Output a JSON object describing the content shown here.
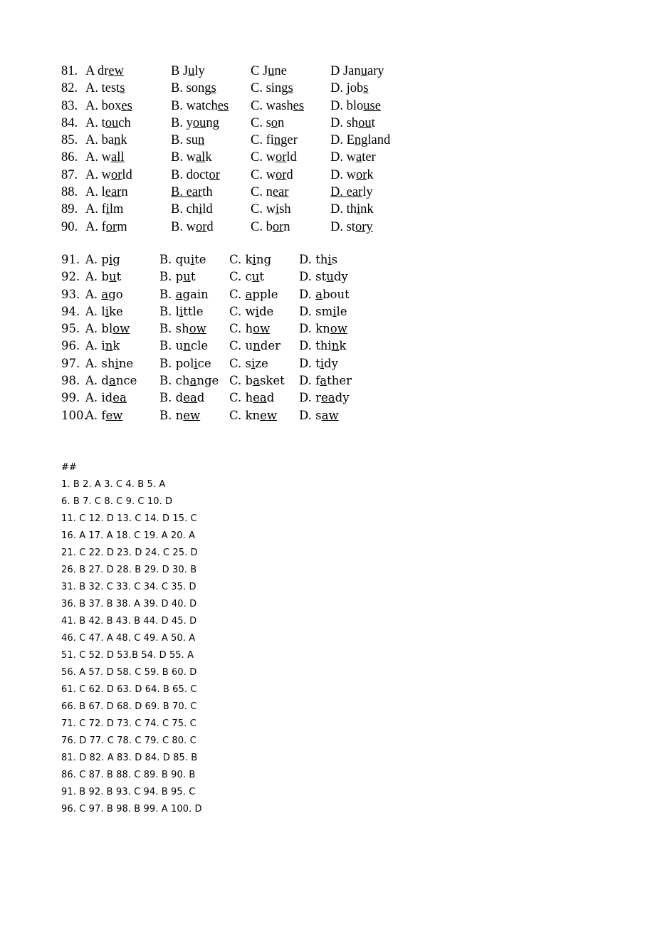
{
  "document": {
    "page_background": "#ffffff",
    "text_color": "#000000"
  },
  "question_blocks": [
    {
      "id": "block-81",
      "rows": [
        {
          "number": "81.",
          "options": [
            {
              "label": "A",
              "pre": "A dr",
              "underlined": "ew",
              "post": "",
              "text": "A drew"
            },
            {
              "label": "B",
              "pre": "B J",
              "underlined": "u",
              "post": "ly",
              "text": "B July"
            },
            {
              "label": "C",
              "pre": "C J",
              "underlined": "u",
              "post": "ne",
              "text": "C June"
            },
            {
              "label": "D",
              "pre": "D Jan",
              "underlined": "u",
              "post": "ary",
              "text": "D January"
            }
          ]
        },
        {
          "number": "82.",
          "options": [
            {
              "label": "A",
              "pre": "A. test",
              "underlined": "s",
              "post": "",
              "text": "A. tests"
            },
            {
              "label": "B",
              "pre": "B. song",
              "underlined": "s",
              "post": "",
              "text": "B. songs"
            },
            {
              "label": "C",
              "pre": "C. sing",
              "underlined": "s",
              "post": "",
              "text": "C. sings"
            },
            {
              "label": "D",
              "pre": "D. job",
              "underlined": "s",
              "post": "",
              "text": "D. jobs"
            }
          ]
        },
        {
          "number": "83.",
          "options": [
            {
              "label": "A",
              "pre": "A. box",
              "underlined": "es",
              "post": "",
              "text": "A. boxes"
            },
            {
              "label": "B",
              "pre": "B. watch",
              "underlined": "es",
              "post": "",
              "text": "B. watches"
            },
            {
              "label": "C",
              "pre": "C. wash",
              "underlined": "es",
              "post": "",
              "text": "C. washes"
            },
            {
              "label": "D",
              "pre": "D. blo",
              "underlined": "use",
              "post": "",
              "text": "D. blouse"
            }
          ]
        },
        {
          "number": "84.",
          "options": [
            {
              "label": "A",
              "pre": "A. t",
              "underlined": "ou",
              "post": "ch",
              "text": "A. touch"
            },
            {
              "label": "B",
              "pre": "B. y",
              "underlined": "ou",
              "post": "ng",
              "text": "B. young"
            },
            {
              "label": "C",
              "pre": "C. s",
              "underlined": "o",
              "post": "n",
              "text": "C. son"
            },
            {
              "label": "D",
              "pre": "D. sh",
              "underlined": "ou",
              "post": "t",
              "text": "D. shout"
            }
          ]
        },
        {
          "number": "85.",
          "options": [
            {
              "label": "A",
              "pre": "A. ba",
              "underlined": "n",
              "post": "k",
              "text": "A. bank"
            },
            {
              "label": "B",
              "pre": "B. su",
              "underlined": "n",
              "post": "",
              "text": "B. sun"
            },
            {
              "label": "C",
              "pre": "C. fi",
              "underlined": "n",
              "post": "ger",
              "text": "C. finger"
            },
            {
              "label": "D",
              "pre": "D. E",
              "underlined": "ng",
              "post": "land",
              "text": "D. England"
            }
          ]
        },
        {
          "number": "86.",
          "options": [
            {
              "label": "A",
              "pre": "A. w",
              "underlined": "all",
              "post": "",
              "text": "A. wall"
            },
            {
              "label": "B",
              "pre": "B. w",
              "underlined": "al",
              "post": "k",
              "text": "B. walk"
            },
            {
              "label": "C",
              "pre": "C. w",
              "underlined": "or",
              "post": "ld",
              "text": "C. world"
            },
            {
              "label": "D",
              "pre": "D. w",
              "underlined": "a",
              "post": "ter",
              "text": "D. water"
            }
          ]
        },
        {
          "number": "87.",
          "options": [
            {
              "label": "A",
              "pre": "A. w",
              "underlined": "or",
              "post": "ld",
              "text": "A. world"
            },
            {
              "label": "B",
              "pre": "B. doct",
              "underlined": "or",
              "post": "",
              "text": "B. doctor"
            },
            {
              "label": "C",
              "pre": "C. w",
              "underlined": "or",
              "post": "d",
              "text": "C. word"
            },
            {
              "label": "D",
              "pre": "D. w",
              "underlined": "or",
              "post": "k",
              "text": "D. work"
            }
          ]
        },
        {
          "number": "88.",
          "options": [
            {
              "label": "A",
              "pre": "A. l",
              "underlined": "ear",
              "post": "n",
              "text": "A. learn"
            },
            {
              "label": "B",
              "pre": "",
              "underlined": "B. ear",
              "post": "th",
              "text": "B. earth"
            },
            {
              "label": "C",
              "pre": "C. n",
              "underlined": "ear",
              "post": "",
              "text": "C. near"
            },
            {
              "label": "D",
              "pre": "",
              "underlined": "D. ear",
              "post": "ly",
              "text": "D. early"
            }
          ]
        },
        {
          "number": "89.",
          "options": [
            {
              "label": "A",
              "pre": "A. f",
              "underlined": "i",
              "post": "lm",
              "text": "A. film"
            },
            {
              "label": "B",
              "pre": "B. ch",
              "underlined": "i",
              "post": "ld",
              "text": "B. child"
            },
            {
              "label": "C",
              "pre": "C. w",
              "underlined": "i",
              "post": "sh",
              "text": "C. wish"
            },
            {
              "label": "D",
              "pre": "D. th",
              "underlined": "i",
              "post": "nk",
              "text": "D. think"
            }
          ]
        },
        {
          "number": "90.",
          "options": [
            {
              "label": "A",
              "pre": "A. f",
              "underlined": "or",
              "post": "m",
              "text": "A. form"
            },
            {
              "label": "B",
              "pre": "B. w",
              "underlined": "or",
              "post": "d",
              "text": "B. word"
            },
            {
              "label": "C",
              "pre": "C. b",
              "underlined": "or",
              "post": "n",
              "text": "C. born"
            },
            {
              "label": "D",
              "pre": "D. st",
              "underlined": "ory",
              "post": "",
              "text": "D. story"
            }
          ]
        }
      ]
    },
    {
      "id": "block-91",
      "rows": [
        {
          "number": "91.",
          "options": [
            {
              "label": "A",
              "pre": "A. p",
              "underlined": "i",
              "post": "g",
              "text": "A. pig"
            },
            {
              "label": "B",
              "pre": "B. qu",
              "underlined": "i",
              "post": "te",
              "text": "B. quite"
            },
            {
              "label": "C",
              "pre": "C. k",
              "underlined": "i",
              "post": "ng",
              "text": "C. king"
            },
            {
              "label": "D",
              "pre": "D. th",
              "underlined": "i",
              "post": "s",
              "text": "D. this"
            }
          ]
        },
        {
          "number": "92.",
          "options": [
            {
              "label": "A",
              "pre": "A. b",
              "underlined": "u",
              "post": "t",
              "text": "A. but"
            },
            {
              "label": "B",
              "pre": "B. p",
              "underlined": "u",
              "post": "t",
              "text": "B. put"
            },
            {
              "label": "C",
              "pre": "C. c",
              "underlined": "u",
              "post": "t",
              "text": "C. cut"
            },
            {
              "label": "D",
              "pre": "D. st",
              "underlined": "u",
              "post": "dy",
              "text": "D. study"
            }
          ]
        },
        {
          "number": "93.",
          "options": [
            {
              "label": "A",
              "pre": "A. ",
              "underlined": "a",
              "post": "go",
              "text": "A. ago"
            },
            {
              "label": "B",
              "pre": "B. ",
              "underlined": "a",
              "post": "gain",
              "text": "B. again"
            },
            {
              "label": "C",
              "pre": "C. ",
              "underlined": "a",
              "post": "pple",
              "text": "C. apple"
            },
            {
              "label": "D",
              "pre": "D. ",
              "underlined": "a",
              "post": "bout",
              "text": "D. about"
            }
          ]
        },
        {
          "number": "94.",
          "options": [
            {
              "label": "A",
              "pre": "A. l",
              "underlined": "i",
              "post": "ke",
              "text": "A. like"
            },
            {
              "label": "B",
              "pre": "B. l",
              "underlined": "i",
              "post": "ttle",
              "text": "B. little"
            },
            {
              "label": "C",
              "pre": "C. w",
              "underlined": "i",
              "post": "de",
              "text": "C. wide"
            },
            {
              "label": "D",
              "pre": "D. sm",
              "underlined": "i",
              "post": "le",
              "text": "D. smile"
            }
          ]
        },
        {
          "number": "95.",
          "options": [
            {
              "label": "A",
              "pre": "A. bl",
              "underlined": "ow",
              "post": "",
              "text": "A. blow"
            },
            {
              "label": "B",
              "pre": "B. sh",
              "underlined": "ow",
              "post": "",
              "text": "B. show"
            },
            {
              "label": "C",
              "pre": "C. h",
              "underlined": "ow",
              "post": "",
              "text": "C. how"
            },
            {
              "label": "D",
              "pre": "D. kn",
              "underlined": "ow",
              "post": "",
              "text": "D. know"
            }
          ]
        },
        {
          "number": "96.",
          "options": [
            {
              "label": "A",
              "pre": "A. i",
              "underlined": "n",
              "post": "k",
              "text": "A. ink"
            },
            {
              "label": "B",
              "pre": "B. u",
              "underlined": "n",
              "post": "cle",
              "text": "B. uncle"
            },
            {
              "label": "C",
              "pre": "C. u",
              "underlined": "n",
              "post": "der",
              "text": "C. under"
            },
            {
              "label": "D",
              "pre": "D. thi",
              "underlined": "n",
              "post": "k",
              "text": "D. think"
            }
          ]
        },
        {
          "number": "97.",
          "options": [
            {
              "label": "A",
              "pre": "A. sh",
              "underlined": "i",
              "post": "ne",
              "text": "A. shine"
            },
            {
              "label": "B",
              "pre": "B. pol",
              "underlined": "i",
              "post": "ce",
              "text": "B. police"
            },
            {
              "label": "C",
              "pre": "C. s",
              "underlined": "i",
              "post": "ze",
              "text": "C. size"
            },
            {
              "label": "D",
              "pre": "D. t",
              "underlined": "i",
              "post": "dy",
              "text": "D. tidy"
            }
          ]
        },
        {
          "number": "98.",
          "options": [
            {
              "label": "A",
              "pre": "A. d",
              "underlined": "a",
              "post": "nce",
              "text": "A. dance"
            },
            {
              "label": "B",
              "pre": "B. ch",
              "underlined": "a",
              "post": "nge",
              "text": "B. change"
            },
            {
              "label": "C",
              "pre": "C. b",
              "underlined": "a",
              "post": "sket",
              "text": "C. basket"
            },
            {
              "label": "D",
              "pre": "D. f",
              "underlined": "a",
              "post": "ther",
              "text": "D. father"
            }
          ]
        },
        {
          "number": "99.",
          "options": [
            {
              "label": "A",
              "pre": "A. id",
              "underlined": "ea",
              "post": "",
              "text": "A. idea"
            },
            {
              "label": "B",
              "pre": "B. d",
              "underlined": "ea",
              "post": "d",
              "text": "B. dead"
            },
            {
              "label": "C",
              "pre": "C. h",
              "underlined": "ea",
              "post": "d",
              "text": "C. head"
            },
            {
              "label": "D",
              "pre": "D. r",
              "underlined": "ea",
              "post": "dy",
              "text": "D. ready"
            }
          ]
        },
        {
          "number": "100.",
          "wide_num": true,
          "options": [
            {
              "label": "A",
              "pre": "A. f",
              "underlined": "ew",
              "post": "",
              "text": "A. few"
            },
            {
              "label": "B",
              "pre": "B. n",
              "underlined": "ew",
              "post": "",
              "text": "B. new"
            },
            {
              "label": "C",
              "pre": "C. kn",
              "underlined": "ew",
              "post": "",
              "text": "C. knew"
            },
            {
              "label": "D",
              "pre": "D. s",
              "underlined": "aw",
              "post": "",
              "text": "D. saw"
            }
          ]
        }
      ]
    }
  ],
  "answer_key": {
    "marker": "##",
    "lines": [
      "1. B 2. A 3. C 4. B 5. A",
      "6. B 7. C 8. C 9. C 10. D",
      "11. C 12. D 13. C 14. D 15. C",
      "16. A 17. A 18. C 19. A 20. A",
      "21. C 22. D 23. D 24. C 25. D",
      "26. B 27. D 28. B 29. D 30. B",
      "31. B 32. C 33. C 34. C 35. D",
      "36. B 37. B 38. A 39. D 40. D",
      "41. B 42. B 43. B 44. D 45. D",
      "46. C 47. A 48. C 49. A 50. A",
      "51. C 52. D 53.B 54. D 55. A",
      "56. A 57. D 58. C 59. B 60. D",
      "61. C 62. D 63. D 64. B 65. C",
      "66. B 67. D 68. D 69. B 70. C",
      "71. C 72. D 73. C 74. C 75. C",
      "76. D 77. C 78. C 79. C 80. C",
      "81. D 82. A 83. D 84. D 85. B",
      "86. C 87. B 88. C 89. B 90. B",
      "91. B 92. B 93. C 94. B 95. C",
      "96. C 97. B 98. B 99. A 100. D"
    ]
  }
}
